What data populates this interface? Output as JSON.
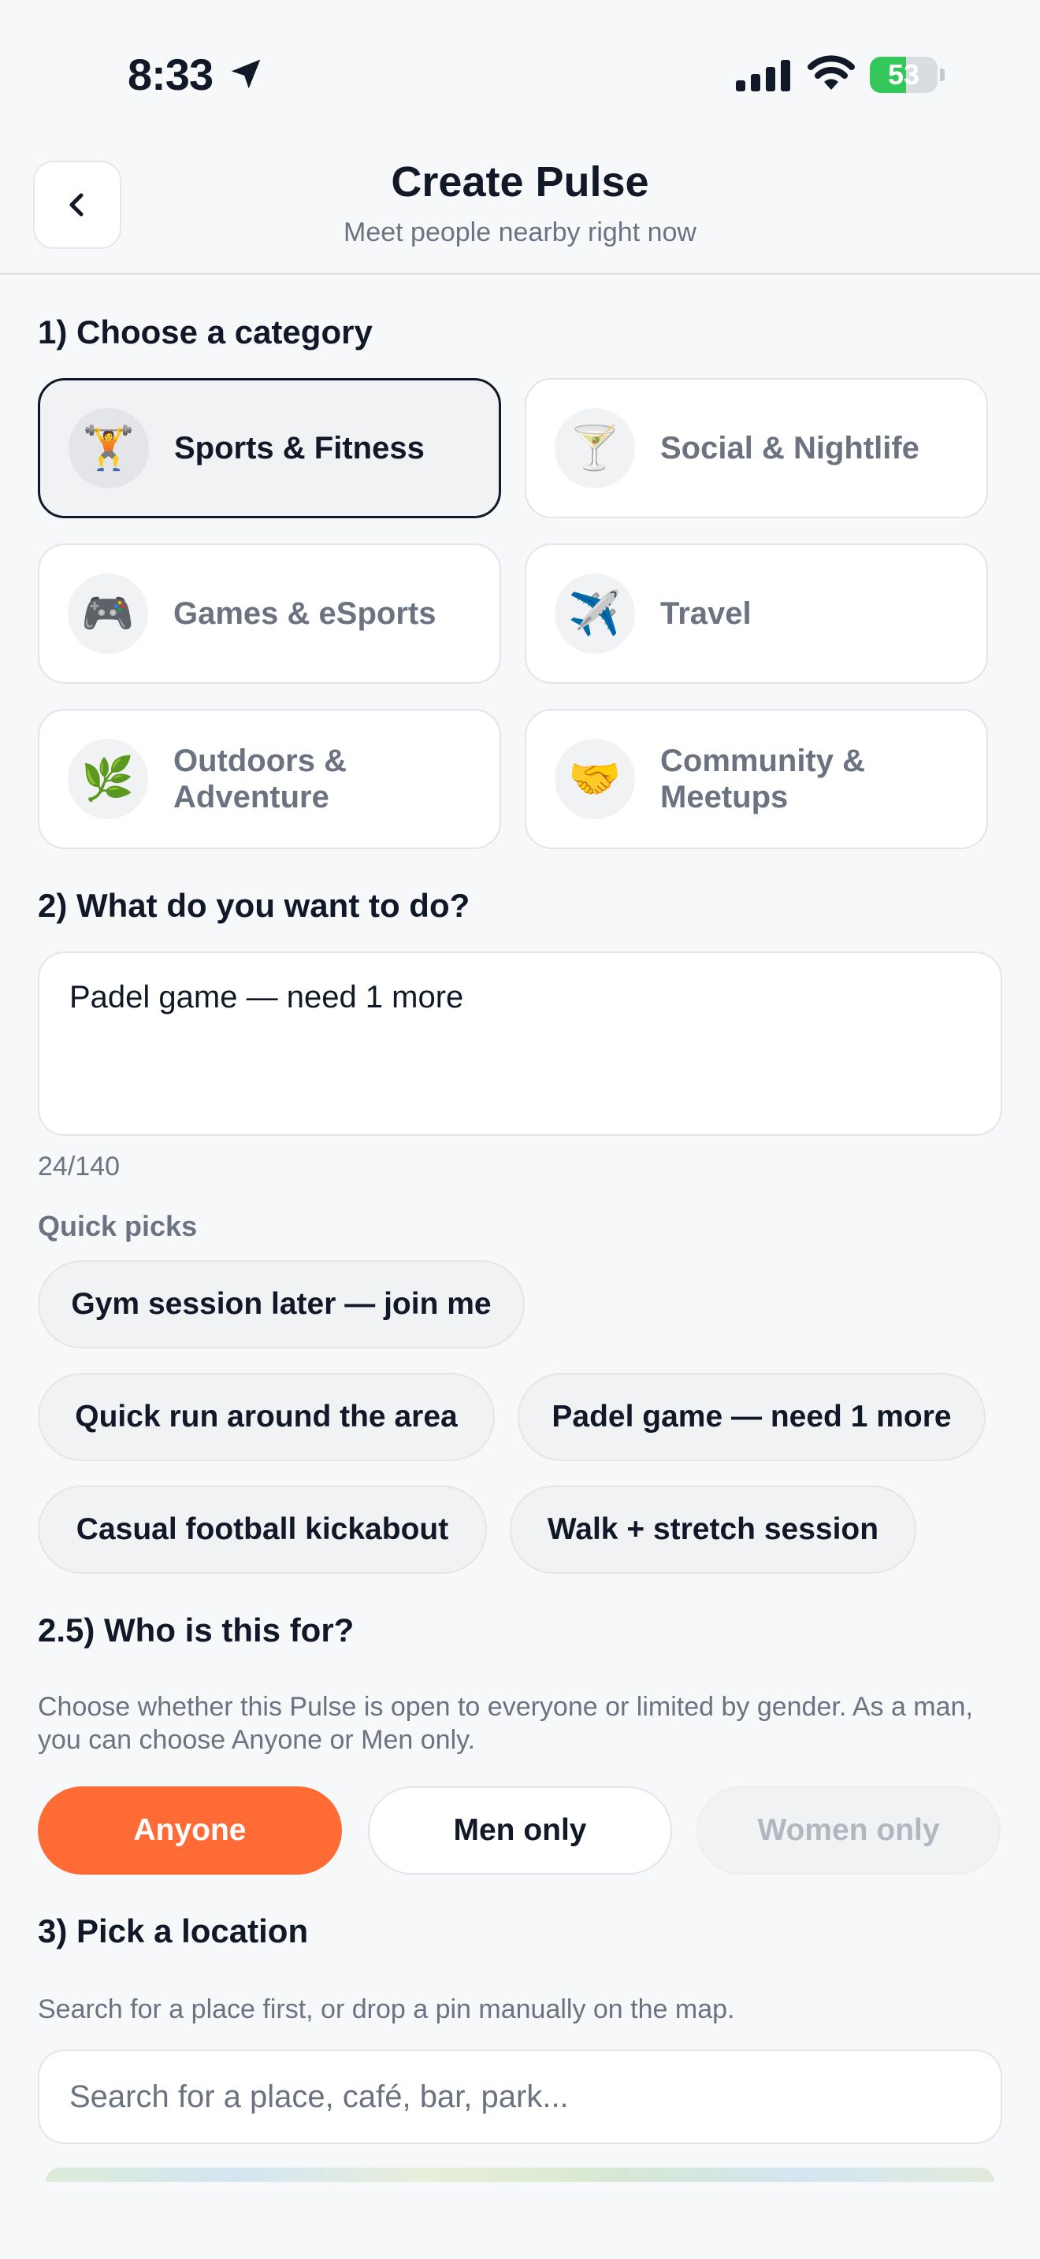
{
  "status_bar": {
    "time": "8:33",
    "battery": "53",
    "battery_level": 0.53
  },
  "header": {
    "title": "Create Pulse",
    "subtitle": "Meet people nearby right now"
  },
  "section1": {
    "heading": "1) Choose a category",
    "categories": [
      {
        "label": "Sports & Fitness",
        "icon": "🏋️",
        "selected": true
      },
      {
        "label": "Social & Nightlife",
        "icon": "🍸",
        "selected": false
      },
      {
        "label": "Games & eSports",
        "icon": "🎮",
        "selected": false
      },
      {
        "label": "Travel",
        "icon": "✈️",
        "selected": false
      },
      {
        "label": "Outdoors & Adventure",
        "icon": "🌿",
        "selected": false
      },
      {
        "label": "Community & Meetups",
        "icon": "🤝",
        "selected": false
      }
    ]
  },
  "section2": {
    "heading": "2) What do you want to do?",
    "value": "Padel game — need 1 more",
    "counter": "24/140",
    "quick_picks_label": "Quick picks",
    "quick_picks": [
      "Gym session later — join me",
      "Quick run around the area",
      "Padel game — need 1 more",
      "Casual football kickabout",
      "Walk + stretch session"
    ]
  },
  "section25": {
    "heading": "2.5) Who is this for?",
    "description": "Choose whether this Pulse is open to everyone or limited by gender. As a man, you can choose Anyone or Men only.",
    "options": [
      "Anyone",
      "Men only",
      "Women only"
    ],
    "selected": "Anyone"
  },
  "section3": {
    "heading": "3) Pick a location",
    "description": "Search for a place first, or drop a pin manually on the map.",
    "search_placeholder": "Search for a place, café, bar, park..."
  },
  "colors": {
    "accent": "#ff6b35",
    "battery_green": "#34c759",
    "text": "#111827",
    "muted": "#6b7280"
  }
}
